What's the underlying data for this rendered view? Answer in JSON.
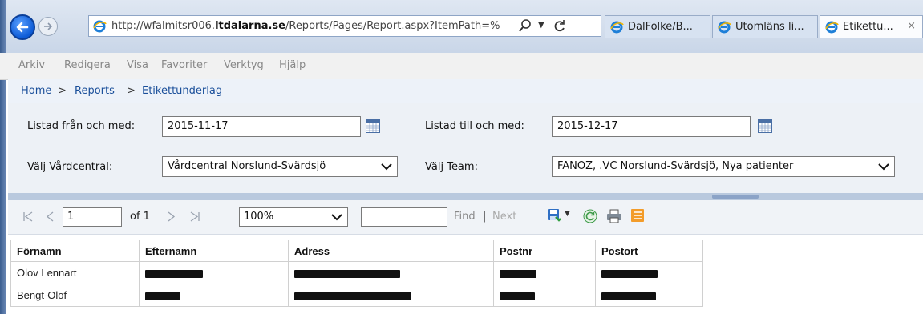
{
  "browser": {
    "url_prefix": "http://wfalmitsr006.",
    "url_domain": "ltdalarna.se",
    "url_suffix": "/Reports/Pages/Report.aspx?ItemPath=%",
    "tabs": [
      {
        "label": "DalFolke/B..."
      },
      {
        "label": "Utomläns li..."
      },
      {
        "label": "Etikettu...",
        "close": "×"
      }
    ]
  },
  "menu": [
    "Arkiv",
    "Redigera",
    "Visa",
    "Favoriter",
    "Verktyg",
    "Hjälp"
  ],
  "breadcrumb": {
    "home": "Home",
    "sep1": ">",
    "reports": "Reports",
    "sep2": ">",
    "current": "Etikettunderlag"
  },
  "params": {
    "from_label": "Listad från och med:",
    "from_value": "2015-11-17",
    "to_label": "Listad till och med:",
    "to_value": "2015-12-17",
    "vc_label": "Välj Vårdcentral:",
    "vc_value": "Vårdcentral Norslund-Svärdsjö",
    "team_label": "Välj Team:",
    "team_value": "FANOZ, .VC Norslund-Svärdsjö,  Nya patienter"
  },
  "toolbar": {
    "page_value": "1",
    "page_of": "of 1",
    "zoom": "100%",
    "find_label": "Find",
    "separator": "|",
    "next_label": "Next"
  },
  "table": {
    "columns": [
      "Förnamn",
      "Efternamn",
      "Adress",
      "Postnr",
      "Postort"
    ],
    "rows": [
      {
        "firstname": "Olov Lennart"
      },
      {
        "firstname": "Bengt-Olof"
      }
    ]
  },
  "colors": {
    "link": "#1a4f9a",
    "params_bg": "#edf1f6",
    "splitter": "#b9c9de"
  }
}
